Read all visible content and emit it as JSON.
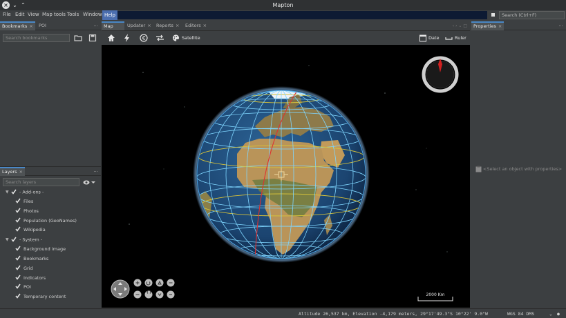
{
  "window": {
    "title": "Mapton"
  },
  "menu": {
    "items": [
      "File",
      "Edit",
      "View",
      "Map tools",
      "Tools",
      "Window",
      "Help"
    ],
    "search_placeholder": "Search (Ctrl+F)"
  },
  "bookmarks_panel": {
    "tabs": [
      {
        "label": "Bookmarks",
        "selected": true
      },
      {
        "label": "POI",
        "selected": false
      }
    ],
    "search_placeholder": "Search bookmarks"
  },
  "layers_panel": {
    "tab": "Layers",
    "search_placeholder": "Search layers",
    "groups": [
      {
        "label": "- Add-ons -",
        "items": [
          "Files",
          "Photos",
          "Population (GeoNames)",
          "Wikipedia"
        ]
      },
      {
        "label": "- System -",
        "items": [
          "Background image",
          "Bookmarks",
          "Grid",
          "Indicators",
          "POI",
          "Temporary content"
        ]
      }
    ]
  },
  "map_tabs": [
    {
      "label": "Map",
      "selected": true
    },
    {
      "label": "Updater",
      "selected": false
    },
    {
      "label": "Reports",
      "selected": false
    },
    {
      "label": "Editors",
      "selected": false
    }
  ],
  "map_toolbar": {
    "satellite_label": "Satellite",
    "date_label": "Date",
    "ruler_label": "Ruler"
  },
  "map": {
    "scale_label": "2000 Km",
    "colors": {
      "ocean": "#1f4d7a",
      "land": "#b39257",
      "graticule": "#7fd6ff",
      "meridian": "#e03030",
      "tropic": "#d6c23a"
    }
  },
  "properties_panel": {
    "tab": "Properties",
    "empty_text": "<Select an object with properties>"
  },
  "status": {
    "readout": "Altitude  26,537 km, Elevation -4,179 meters, 29°17'49.3\"S  10°22' 9.0\"W",
    "crs": "WGS 84 DMS"
  }
}
